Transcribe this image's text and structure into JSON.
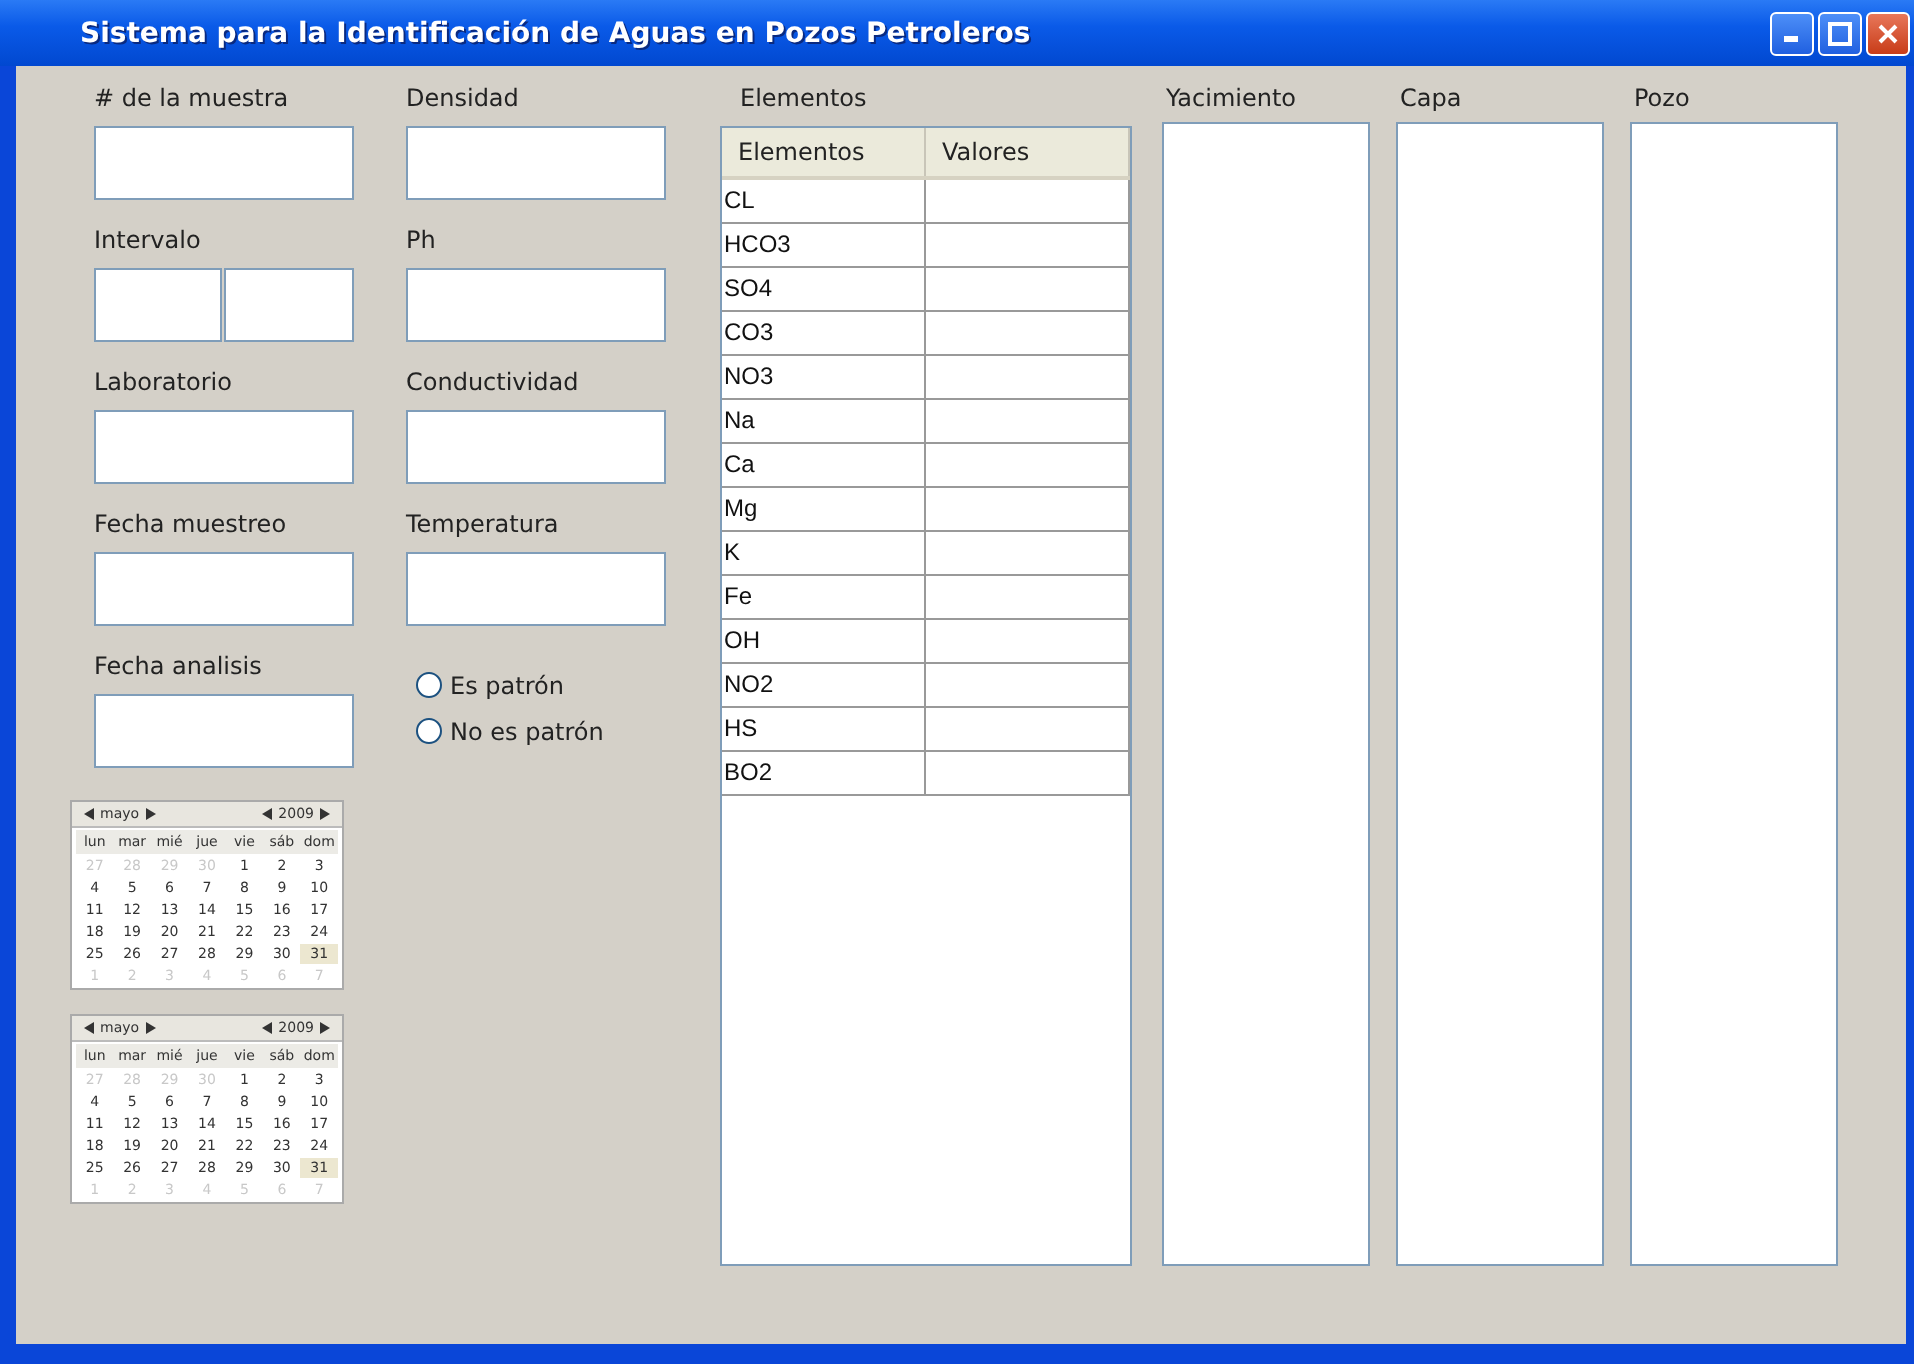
{
  "window": {
    "title": "Sistema para la Identificación de Aguas en Pozos Petroleros"
  },
  "left_fields": [
    {
      "label": "# de la muestra",
      "kind": "single"
    },
    {
      "label": "Intervalo",
      "kind": "double"
    },
    {
      "label": "Laboratorio",
      "kind": "single"
    },
    {
      "label": "Fecha muestreo",
      "kind": "single"
    },
    {
      "label": "Fecha analisis",
      "kind": "single"
    }
  ],
  "right_fields": [
    {
      "label": "Densidad"
    },
    {
      "label": "Ph"
    },
    {
      "label": "Conductividad"
    },
    {
      "label": "Temperatura"
    }
  ],
  "radios": [
    {
      "label": "Es patrón",
      "selected": false
    },
    {
      "label": "No es patrón",
      "selected": false
    }
  ],
  "calendars": [
    {
      "month": "mayo",
      "year": "2009",
      "weekdays": [
        "lun",
        "mar",
        "mié",
        "jue",
        "vie",
        "sáb",
        "dom"
      ],
      "days": [
        {
          "label": "27",
          "outside": true,
          "selected": false
        },
        {
          "label": "28",
          "outside": true,
          "selected": false
        },
        {
          "label": "29",
          "outside": true,
          "selected": false
        },
        {
          "label": "30",
          "outside": true,
          "selected": false
        },
        {
          "label": "1",
          "outside": false,
          "selected": false
        },
        {
          "label": "2",
          "outside": false,
          "selected": false
        },
        {
          "label": "3",
          "outside": false,
          "selected": false
        },
        {
          "label": "4",
          "outside": false,
          "selected": false
        },
        {
          "label": "5",
          "outside": false,
          "selected": false
        },
        {
          "label": "6",
          "outside": false,
          "selected": false
        },
        {
          "label": "7",
          "outside": false,
          "selected": false
        },
        {
          "label": "8",
          "outside": false,
          "selected": false
        },
        {
          "label": "9",
          "outside": false,
          "selected": false
        },
        {
          "label": "10",
          "outside": false,
          "selected": false
        },
        {
          "label": "11",
          "outside": false,
          "selected": false
        },
        {
          "label": "12",
          "outside": false,
          "selected": false
        },
        {
          "label": "13",
          "outside": false,
          "selected": false
        },
        {
          "label": "14",
          "outside": false,
          "selected": false
        },
        {
          "label": "15",
          "outside": false,
          "selected": false
        },
        {
          "label": "16",
          "outside": false,
          "selected": false
        },
        {
          "label": "17",
          "outside": false,
          "selected": false
        },
        {
          "label": "18",
          "outside": false,
          "selected": false
        },
        {
          "label": "19",
          "outside": false,
          "selected": false
        },
        {
          "label": "20",
          "outside": false,
          "selected": false
        },
        {
          "label": "21",
          "outside": false,
          "selected": false
        },
        {
          "label": "22",
          "outside": false,
          "selected": false
        },
        {
          "label": "23",
          "outside": false,
          "selected": false
        },
        {
          "label": "24",
          "outside": false,
          "selected": false
        },
        {
          "label": "25",
          "outside": false,
          "selected": false
        },
        {
          "label": "26",
          "outside": false,
          "selected": false
        },
        {
          "label": "27",
          "outside": false,
          "selected": false
        },
        {
          "label": "28",
          "outside": false,
          "selected": false
        },
        {
          "label": "29",
          "outside": false,
          "selected": false
        },
        {
          "label": "30",
          "outside": false,
          "selected": false
        },
        {
          "label": "31",
          "outside": false,
          "selected": true
        },
        {
          "label": "1",
          "outside": true,
          "selected": false
        },
        {
          "label": "2",
          "outside": true,
          "selected": false
        },
        {
          "label": "3",
          "outside": true,
          "selected": false
        },
        {
          "label": "4",
          "outside": true,
          "selected": false
        },
        {
          "label": "5",
          "outside": true,
          "selected": false
        },
        {
          "label": "6",
          "outside": true,
          "selected": false
        },
        {
          "label": "7",
          "outside": true,
          "selected": false
        }
      ]
    },
    {
      "month": "mayo",
      "year": "2009",
      "weekdays": [
        "lun",
        "mar",
        "mié",
        "jue",
        "vie",
        "sáb",
        "dom"
      ],
      "days": [
        {
          "label": "27",
          "outside": true,
          "selected": false
        },
        {
          "label": "28",
          "outside": true,
          "selected": false
        },
        {
          "label": "29",
          "outside": true,
          "selected": false
        },
        {
          "label": "30",
          "outside": true,
          "selected": false
        },
        {
          "label": "1",
          "outside": false,
          "selected": false
        },
        {
          "label": "2",
          "outside": false,
          "selected": false
        },
        {
          "label": "3",
          "outside": false,
          "selected": false
        },
        {
          "label": "4",
          "outside": false,
          "selected": false
        },
        {
          "label": "5",
          "outside": false,
          "selected": false
        },
        {
          "label": "6",
          "outside": false,
          "selected": false
        },
        {
          "label": "7",
          "outside": false,
          "selected": false
        },
        {
          "label": "8",
          "outside": false,
          "selected": false
        },
        {
          "label": "9",
          "outside": false,
          "selected": false
        },
        {
          "label": "10",
          "outside": false,
          "selected": false
        },
        {
          "label": "11",
          "outside": false,
          "selected": false
        },
        {
          "label": "12",
          "outside": false,
          "selected": false
        },
        {
          "label": "13",
          "outside": false,
          "selected": false
        },
        {
          "label": "14",
          "outside": false,
          "selected": false
        },
        {
          "label": "15",
          "outside": false,
          "selected": false
        },
        {
          "label": "16",
          "outside": false,
          "selected": false
        },
        {
          "label": "17",
          "outside": false,
          "selected": false
        },
        {
          "label": "18",
          "outside": false,
          "selected": false
        },
        {
          "label": "19",
          "outside": false,
          "selected": false
        },
        {
          "label": "20",
          "outside": false,
          "selected": false
        },
        {
          "label": "21",
          "outside": false,
          "selected": false
        },
        {
          "label": "22",
          "outside": false,
          "selected": false
        },
        {
          "label": "23",
          "outside": false,
          "selected": false
        },
        {
          "label": "24",
          "outside": false,
          "selected": false
        },
        {
          "label": "25",
          "outside": false,
          "selected": false
        },
        {
          "label": "26",
          "outside": false,
          "selected": false
        },
        {
          "label": "27",
          "outside": false,
          "selected": false
        },
        {
          "label": "28",
          "outside": false,
          "selected": false
        },
        {
          "label": "29",
          "outside": false,
          "selected": false
        },
        {
          "label": "30",
          "outside": false,
          "selected": false
        },
        {
          "label": "31",
          "outside": false,
          "selected": true
        },
        {
          "label": "1",
          "outside": true,
          "selected": false
        },
        {
          "label": "2",
          "outside": true,
          "selected": false
        },
        {
          "label": "3",
          "outside": true,
          "selected": false
        },
        {
          "label": "4",
          "outside": true,
          "selected": false
        },
        {
          "label": "5",
          "outside": true,
          "selected": false
        },
        {
          "label": "6",
          "outside": true,
          "selected": false
        },
        {
          "label": "7",
          "outside": true,
          "selected": false
        }
      ]
    }
  ],
  "elements_table": {
    "label": "Elementos",
    "columns": [
      "Elementos",
      "Valores"
    ],
    "rows": [
      "CL",
      "HCO3",
      "SO4",
      "CO3",
      "NO3",
      "Na",
      "Ca",
      "Mg",
      "K",
      "Fe",
      "OH",
      "NO2",
      "HS",
      "BO2"
    ]
  },
  "lists": [
    {
      "label": "Yacimiento"
    },
    {
      "label": "Capa"
    },
    {
      "label": "Pozo"
    }
  ]
}
